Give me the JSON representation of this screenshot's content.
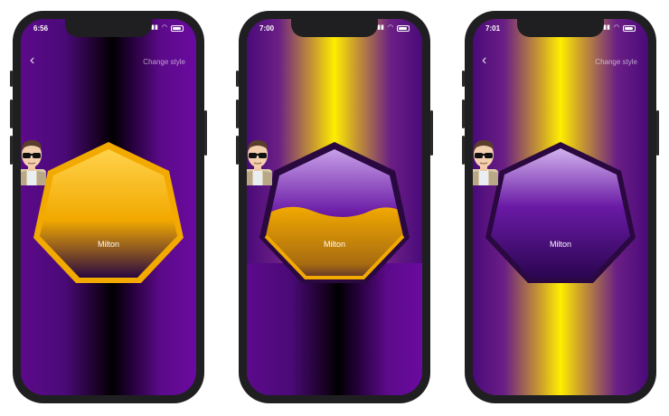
{
  "phones": [
    {
      "status_time": "6:56",
      "nav": {
        "back": "‹",
        "change_style": "Change style"
      },
      "badge": {
        "name": "Milton",
        "fill": "gold"
      }
    },
    {
      "status_time": "7:00",
      "nav": {
        "back": "",
        "change_style": ""
      },
      "badge": {
        "name": "Milton",
        "fill": "wave"
      }
    },
    {
      "status_time": "7:01",
      "nav": {
        "back": "‹",
        "change_style": "Change style"
      },
      "badge": {
        "name": "Milton",
        "fill": "purple"
      }
    }
  ],
  "colors": {
    "purple": "#5c0a8a",
    "gold": "#f2a900",
    "gold_light": "#ffd24a",
    "yellow": "#ffee00",
    "black": "#000000"
  }
}
